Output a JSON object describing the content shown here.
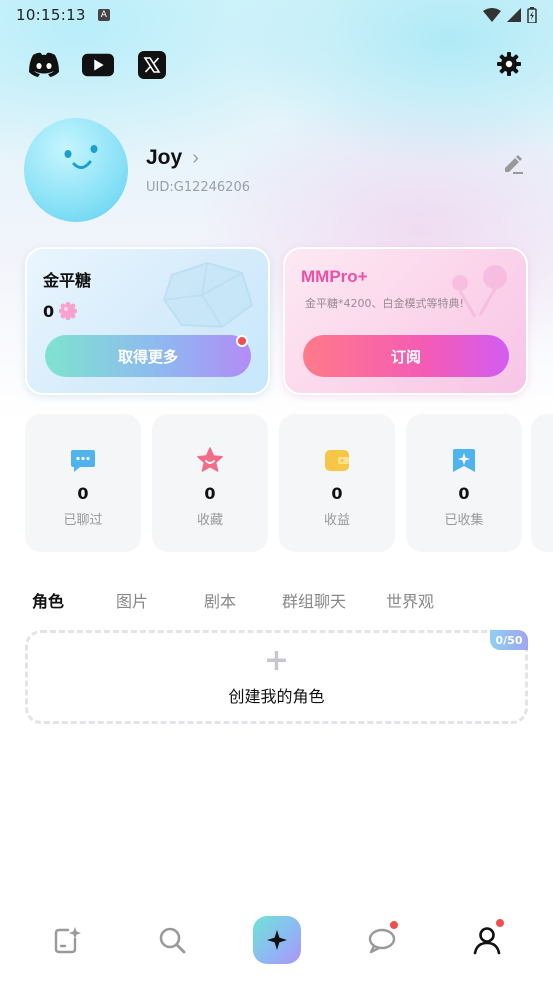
{
  "status_bar": {
    "time": "10:15:13",
    "a_badge": "A"
  },
  "social": [
    {
      "name": "discord-icon"
    },
    {
      "name": "youtube-icon"
    },
    {
      "name": "x-icon",
      "glyph": "𝕏"
    }
  ],
  "profile": {
    "name": "Joy",
    "chevron": "›",
    "uid": "UID:G12246206"
  },
  "cards": {
    "sugar": {
      "title": "金平糖",
      "count": "0",
      "button": "取得更多"
    },
    "pro": {
      "title": "MMPro+",
      "desc": "金平糖*4200、白金模式等特典!",
      "button": "订阅"
    }
  },
  "stats": [
    {
      "value": "0",
      "label": "已聊过",
      "icon": "chat-bubble-icon",
      "color": "#4fb3ef"
    },
    {
      "value": "0",
      "label": "收藏",
      "icon": "star-icon",
      "color": "#f36c8a"
    },
    {
      "value": "0",
      "label": "收益",
      "icon": "wallet-icon",
      "color": "#f7c548"
    },
    {
      "value": "0",
      "label": "已收集",
      "icon": "bookmark-sparkle-icon",
      "color": "#4fb3ef"
    }
  ],
  "tabs": [
    {
      "label": "角色",
      "active": true
    },
    {
      "label": "图片",
      "active": false
    },
    {
      "label": "剧本",
      "active": false
    },
    {
      "label": "群组聊天",
      "active": false
    },
    {
      "label": "世界观",
      "active": false
    }
  ],
  "create": {
    "plus": "+",
    "label": "创建我的角色",
    "count": "0/50"
  },
  "bottom_nav": [
    {
      "icon": "create-note-icon",
      "badge": false
    },
    {
      "icon": "search-icon",
      "badge": false
    },
    {
      "icon": "sparkle-icon",
      "badge": false
    },
    {
      "icon": "chat-icon",
      "badge": true
    },
    {
      "icon": "profile-icon",
      "badge": true
    }
  ],
  "colors": {
    "accent_pink": "#ef4fa6",
    "badge_red": "#f24e4e"
  }
}
